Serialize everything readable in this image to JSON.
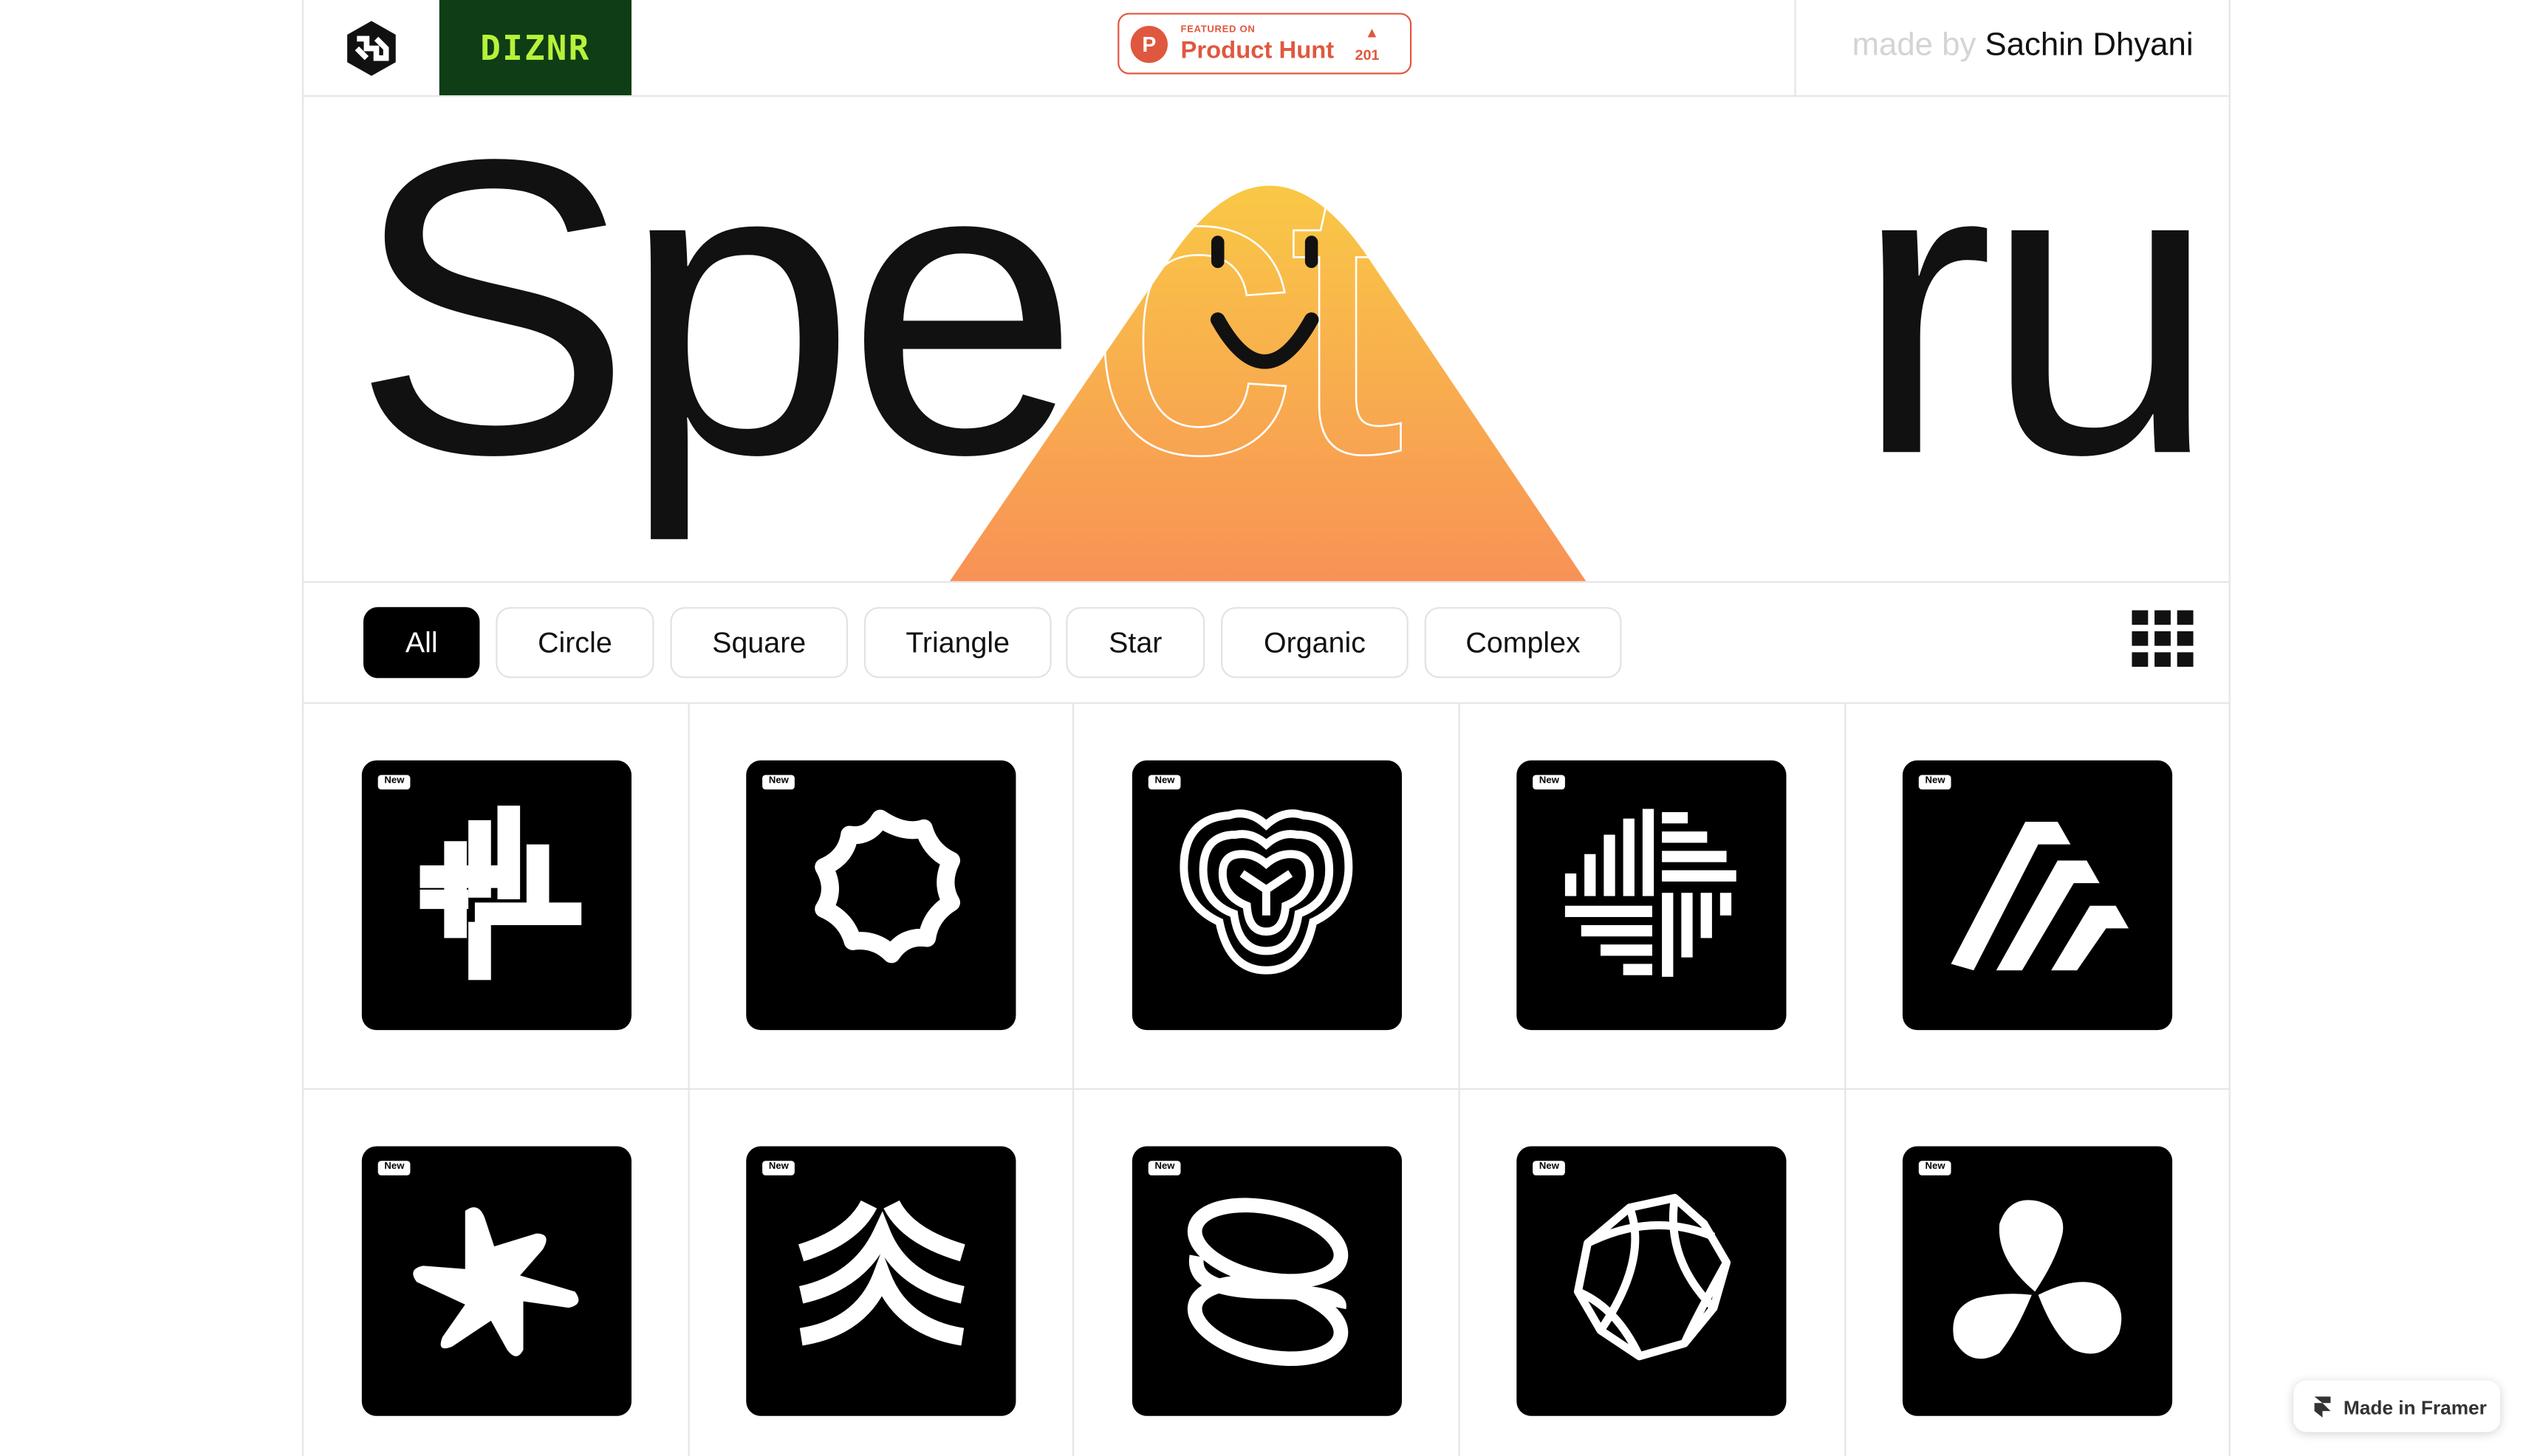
{
  "header": {
    "brand_name": "DIZNR",
    "product_hunt": {
      "featured_label": "FEATURED ON",
      "name": "Product Hunt",
      "upvote_count": "201",
      "logo_letter": "P",
      "color": "#e0573f"
    },
    "credit_prefix": "made by",
    "credit_name": "Sachin Dhyani"
  },
  "hero": {
    "title": "Spectrum",
    "title_part_1": "Spe",
    "title_part_2": "ct",
    "title_part_3": "rum",
    "gradient_top": "#f9c846",
    "gradient_bottom": "#f89256"
  },
  "filters": {
    "items": [
      {
        "label": "All",
        "active": true
      },
      {
        "label": "Circle",
        "active": false
      },
      {
        "label": "Square",
        "active": false
      },
      {
        "label": "Triangle",
        "active": false
      },
      {
        "label": "Star",
        "active": false
      },
      {
        "label": "Organic",
        "active": false
      },
      {
        "label": "Complex",
        "active": false
      }
    ],
    "view_toggle_icon": "grid-icon"
  },
  "shapes": {
    "badge_label": "New",
    "items": [
      {
        "icon": "crossed-bars-icon"
      },
      {
        "icon": "wavy-ring-icon"
      },
      {
        "icon": "concentric-trefoil-icon"
      },
      {
        "icon": "striped-diamond-icon"
      },
      {
        "icon": "slanted-stripes-icon"
      },
      {
        "icon": "rounded-star-icon"
      },
      {
        "icon": "peaked-arcs-icon"
      },
      {
        "icon": "twisted-loops-icon"
      },
      {
        "icon": "octagon-weave-icon"
      },
      {
        "icon": "three-blade-propeller-icon"
      }
    ]
  },
  "footer": {
    "framer_label": "Made in Framer"
  }
}
